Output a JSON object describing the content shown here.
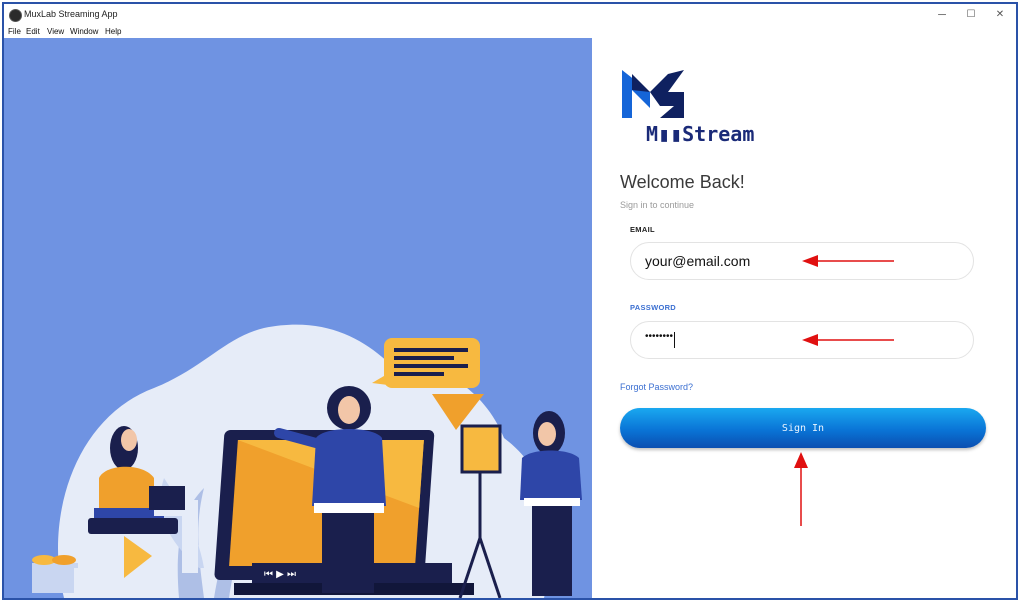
{
  "window": {
    "title": "MuxLab Streaming App",
    "controls": {
      "minimize": "─",
      "maximize": "☐",
      "close": "✕"
    }
  },
  "menu": [
    "File",
    "Edit",
    "View",
    "Window",
    "Help"
  ],
  "logo": {
    "wordmark": "M▮▮Stream",
    "color": "#1a2a78"
  },
  "login": {
    "heading": "Welcome Back!",
    "subheading": "Sign in to continue",
    "email_label": "EMAIL",
    "email_value": "your@email.com",
    "password_label": "PASSWORD",
    "password_value": "••••••••",
    "forgot_link": "Forgot Password?",
    "submit_label": "Sign In"
  },
  "colors": {
    "illustration_bg": "#6f93e2",
    "password_label": "#3b6fd1",
    "button_top": "#1aa8f0",
    "button_bottom": "#0b4fb1",
    "annotation_arrow": "#e01010"
  }
}
